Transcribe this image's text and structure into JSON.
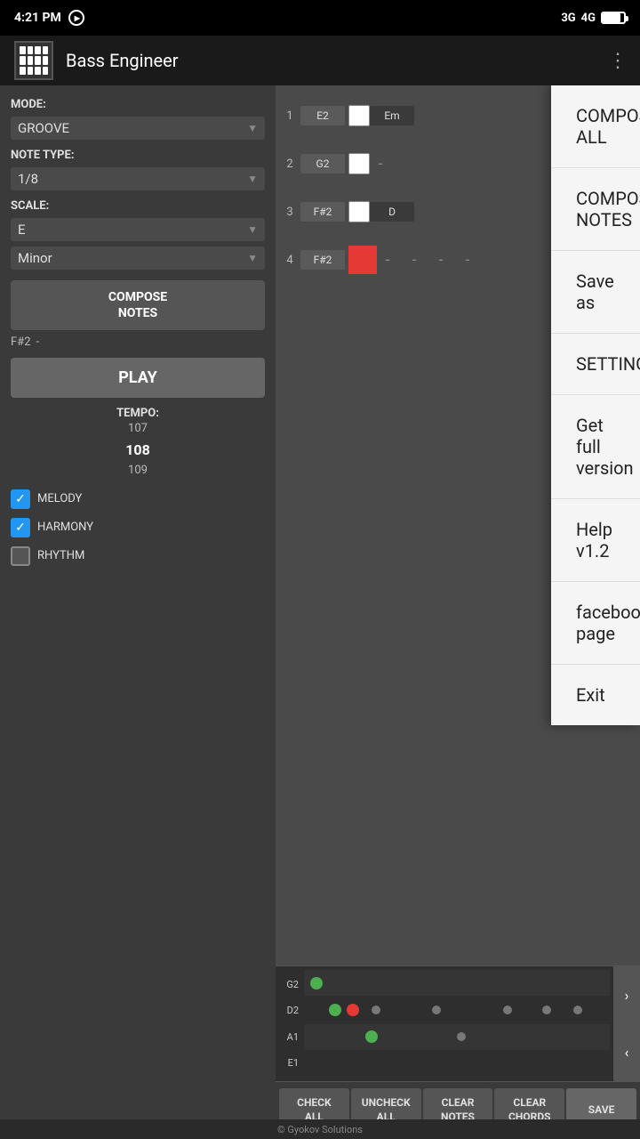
{
  "status": {
    "time": "4:21 PM",
    "signal1": "3G",
    "signal2": "4G"
  },
  "appbar": {
    "title": "Bass Engineer",
    "more_icon": "⋮"
  },
  "left_panel": {
    "mode_label": "MODE:",
    "mode_value": "GROOVE",
    "note_type_label": "NOTE TYPE:",
    "note_type_value": "1/8",
    "scale_label": "SCALE:",
    "scale_value": "E",
    "scale_type": "Minor",
    "compose_notes": "COMPOSE\nNOTES",
    "f2_label": "F#2",
    "f2_dash": "-",
    "play": "PLAY",
    "tempo_label": "TEMPO:",
    "tempo_prev": "107",
    "tempo_current": "108",
    "tempo_next": "109",
    "melody_label": "MELODY",
    "harmony_label": "HARMONY",
    "rhythm_label": "RHYTHM"
  },
  "grid": {
    "rows": [
      {
        "num": "1",
        "note1": "E2",
        "note2": "Em",
        "checked": false
      },
      {
        "num": "2",
        "note1": "G2",
        "note2": "-",
        "checked": false
      },
      {
        "num": "3",
        "note1": "F#2",
        "note2": "D",
        "checked": false
      },
      {
        "num": "4",
        "note1": "F#2",
        "note2": "",
        "checked": true,
        "red": true
      }
    ]
  },
  "piano_roll": {
    "labels": [
      "G2",
      "D2",
      "A1",
      "E1"
    ],
    "scroll_up": ">",
    "scroll_down": "<"
  },
  "bottom_buttons": {
    "check_all": "CHECK\nALL",
    "uncheck_all": "UNCHECK\nALL",
    "clear_notes": "CLEAR\nNOTES",
    "clear_chords": "CLEAR\nCHORDS",
    "save": "SAVE"
  },
  "dropdown": {
    "items": [
      "COMPOSE ALL",
      "COMPOSE NOTES",
      "Save as",
      "SETTINGS",
      "Get full version",
      "Help v1.2",
      "facebook page",
      "Exit"
    ]
  },
  "copyright": "© Gyokov Solutions"
}
